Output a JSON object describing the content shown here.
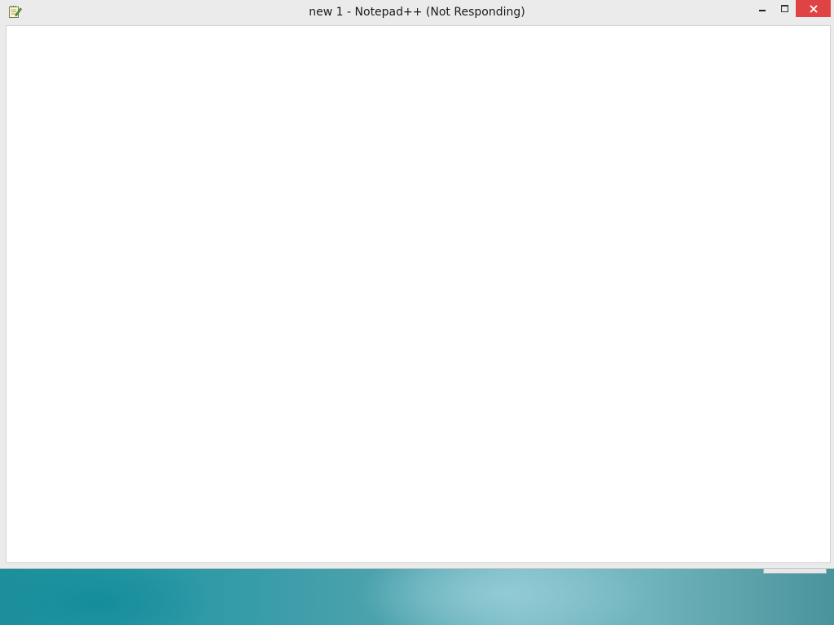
{
  "window": {
    "title": "new 1 - Notepad++ (Not Responding)",
    "app_icon": "notepad-icon",
    "caption_buttons": {
      "minimize_icon": "minimize-icon",
      "maximize_icon": "maximize-icon",
      "close_icon": "close-icon"
    },
    "close_color": "#e04343"
  },
  "editor": {
    "content": ""
  },
  "desktop": {
    "background_colors": [
      "#1c8f9c",
      "#7cbdc6",
      "#4a939c"
    ]
  }
}
